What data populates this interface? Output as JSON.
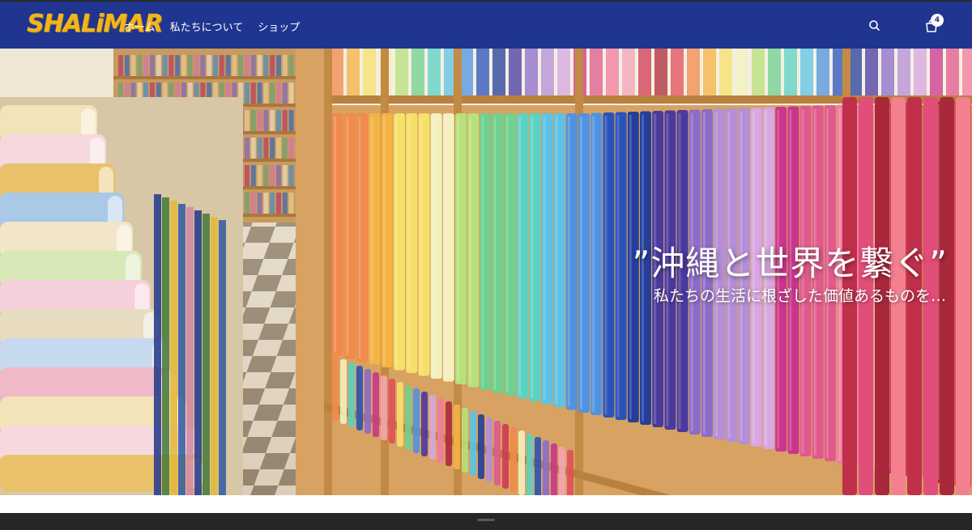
{
  "brand": {
    "logo_text": "SHALiMAR",
    "header_color": "#1f3590",
    "logo_color": "#f2b51c"
  },
  "nav": {
    "items": [
      "ホーム",
      "私たちについて",
      "ショップ"
    ]
  },
  "header": {
    "search_icon": "search-icon",
    "cart_icon": "shopping-bag-icon",
    "cart_count": "4"
  },
  "hero": {
    "title": "”沖縄と世界を繋ぐ”",
    "subtitle": "私たちの生活に根ざした価値あるものを…"
  },
  "footer": {
    "background": "#262626"
  }
}
